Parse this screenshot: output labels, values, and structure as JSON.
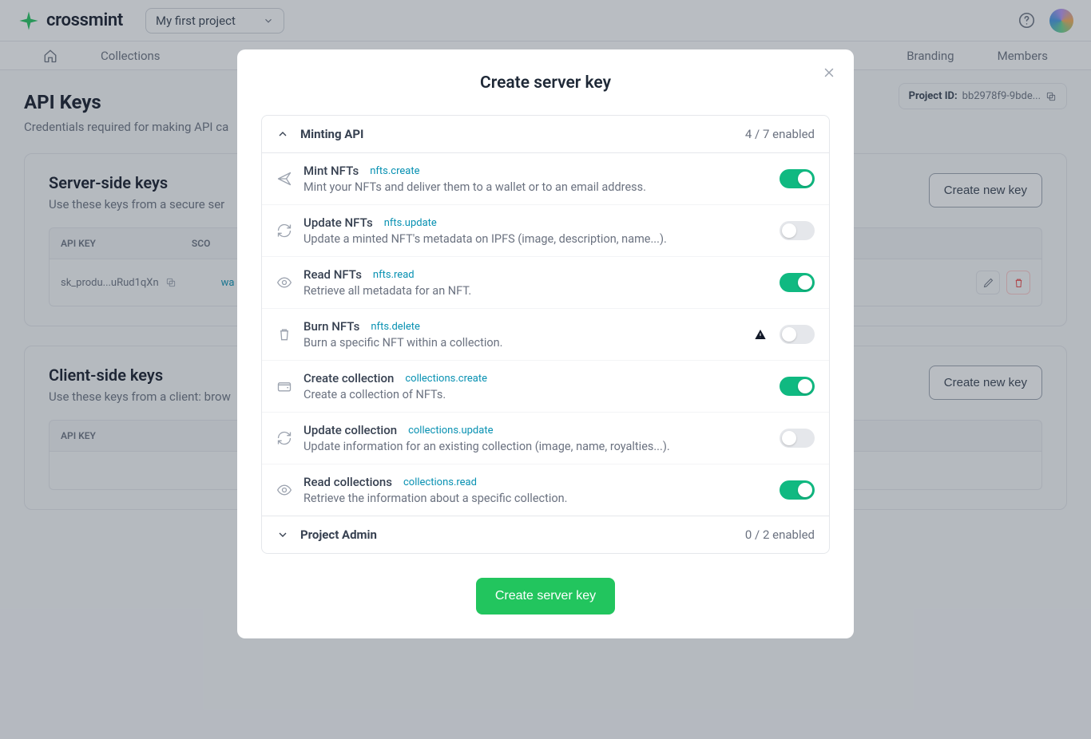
{
  "brand": "crossmint",
  "project_selector": "My first project",
  "nav": [
    "Collections",
    "Branding",
    "Members"
  ],
  "page": {
    "title": "API Keys",
    "desc": "Credentials required for making API ca",
    "project_id_label": "Project ID:",
    "project_id_value": "bb2978f9-9bde..."
  },
  "server": {
    "title": "Server-side keys",
    "desc": "Use these keys from a secure ser",
    "create_btn": "Create new key",
    "th_key": "API KEY",
    "th_sco": "SCO",
    "row_key": "sk_produ...uRud1qXn",
    "row_sco": "wa"
  },
  "client": {
    "title": "Client-side keys",
    "desc": "Use these keys from a client: brow",
    "create_btn": "Create new key",
    "th_key": "API KEY"
  },
  "modal": {
    "title": "Create server key",
    "submit": "Create server key",
    "groups": [
      {
        "name": "Minting API",
        "count": "4 / 7 enabled",
        "expanded": true
      },
      {
        "name": "Project Admin",
        "count": "0 / 2 enabled",
        "expanded": false
      }
    ],
    "scopes": [
      {
        "name": "Mint NFTs",
        "perm": "nfts.create",
        "desc": "Mint your NFTs and deliver them to a wallet or to an email address.",
        "on": true,
        "icon": "send",
        "warn": false
      },
      {
        "name": "Update NFTs",
        "perm": "nfts.update",
        "desc": "Update a minted NFT's metadata on IPFS (image, description, name...).",
        "on": false,
        "icon": "refresh",
        "warn": false
      },
      {
        "name": "Read NFTs",
        "perm": "nfts.read",
        "desc": "Retrieve all metadata for an NFT.",
        "on": true,
        "icon": "eye",
        "warn": false
      },
      {
        "name": "Burn NFTs",
        "perm": "nfts.delete",
        "desc": "Burn a specific NFT within a collection.",
        "on": false,
        "icon": "trash",
        "warn": true
      },
      {
        "name": "Create collection",
        "perm": "collections.create",
        "desc": "Create a collection of NFTs.",
        "on": true,
        "icon": "wallet",
        "warn": false
      },
      {
        "name": "Update collection",
        "perm": "collections.update",
        "desc": "Update information for an existing collection (image, name, royalties...).",
        "on": false,
        "icon": "refresh",
        "warn": false
      },
      {
        "name": "Read collections",
        "perm": "collections.read",
        "desc": "Retrieve the information about a specific collection.",
        "on": true,
        "icon": "eye",
        "warn": false
      }
    ]
  }
}
